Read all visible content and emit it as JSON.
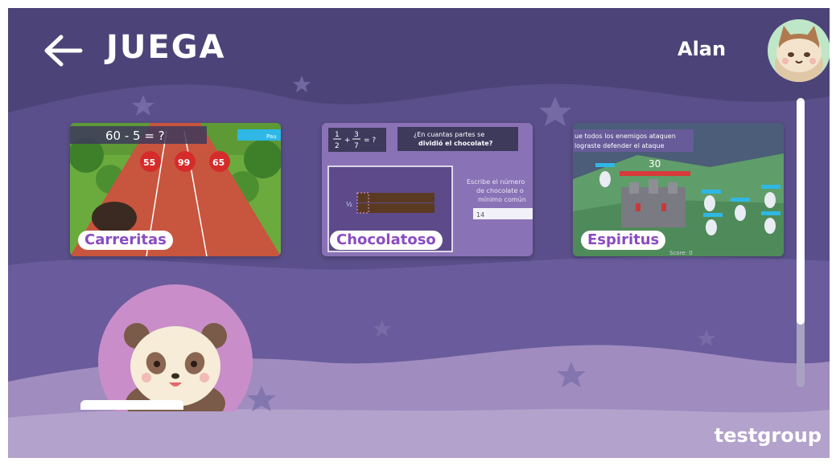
{
  "header": {
    "back_icon": "arrow-left-icon",
    "title": "JUEGA",
    "user_name": "Alan",
    "avatar_icon": "cat-avatar-icon"
  },
  "games": [
    {
      "label": "Carreritas",
      "thumbnail": {
        "question": "60 - 5 = ?",
        "options": [
          "55",
          "99",
          "65"
        ],
        "pause_label": "Pau"
      }
    },
    {
      "label": "Chocolatoso",
      "thumbnail": {
        "fraction_a": {
          "num": "1",
          "den": "2"
        },
        "fraction_b": {
          "num": "3",
          "den": "7"
        },
        "equals": "= ?",
        "question_line1": "¿En cuantas partes se",
        "question_line2": "dividió el chocolate?",
        "hint_line1": "Escribe el número",
        "hint_line2": "de chocolate o",
        "hint_line3": "mínimo común",
        "input_value": "14"
      }
    },
    {
      "label": "Espiritus",
      "thumbnail": {
        "banner_line1": "ue todos los enemigos ataquen",
        "banner_line2": "lograste defender el ataque",
        "counter": "30",
        "score": "Score: 0"
      }
    }
  ],
  "next_row": {
    "avatar_icon": "panda-avatar-icon"
  },
  "footer": {
    "group_name": "testgroup"
  },
  "colors": {
    "background": "#4c4478",
    "wave_light": "#a08cbf",
    "label_text": "#8a4cc2",
    "label_bg": "#ffffff"
  }
}
